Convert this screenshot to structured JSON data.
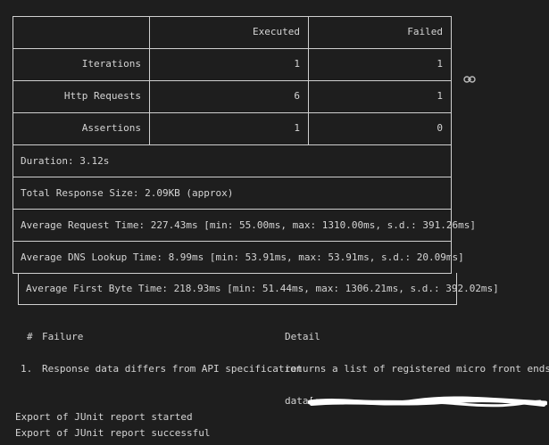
{
  "table": {
    "header": {
      "executed": "Executed",
      "failed": "Failed"
    },
    "rows": [
      {
        "label": "Iterations",
        "executed": "1",
        "failed": "1"
      },
      {
        "label": "Http Requests",
        "executed": "6",
        "failed": "1"
      },
      {
        "label": "Assertions",
        "executed": "1",
        "failed": "0"
      }
    ]
  },
  "summary": [
    "Duration: 3.12s",
    "Total Response Size: 2.09KB (approx)",
    "Average Request Time: 227.43ms [min: 55.00ms, max: 1310.00ms, s.d.: 391.26ms]",
    "Average DNS Lookup Time: 8.99ms [min: 53.91ms, max: 53.91ms, s.d.: 20.09ms]",
    "Average First Byte Time: 218.93ms [min: 51.44ms, max: 1306.21ms, s.d.: 392.02ms]"
  ],
  "failures": {
    "header_num": "#",
    "header_failure": "Failure",
    "header_detail": "Detail",
    "items": [
      {
        "num": "1.",
        "failure": "Response data differs from API specification",
        "detail": "returns a list of registered micro front ends.",
        "detail_extra": "data["
      }
    ]
  },
  "log": [
    "Export of JUnit report started",
    "Export of JUnit report successful"
  ],
  "icons": {
    "link": "link-icon"
  }
}
